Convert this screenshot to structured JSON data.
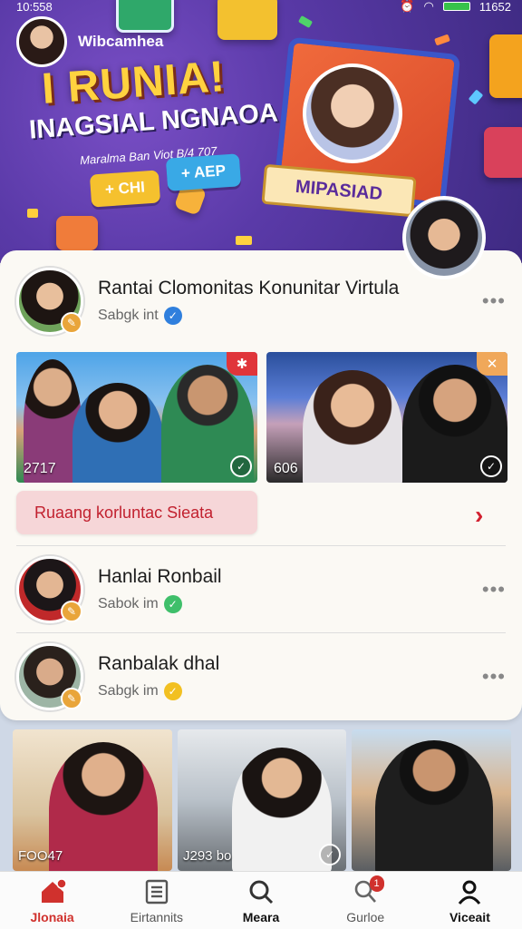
{
  "status_bar": {
    "time": "10:558",
    "right_text": "11652"
  },
  "banner": {
    "username": "Wibcamhea",
    "title": "I RUNIA!",
    "subtitle": "INAGSIAL NGNAOA",
    "caption": "Maralma Ban Viot B/4 707",
    "pill_left": "+ CHI",
    "pill_right": "+ AEP",
    "tag": "MIPASIAD"
  },
  "feed": {
    "post1": {
      "title": "Rantai Clomonitas Konunitar Virtula",
      "subtitle": "Sabgk int",
      "more": "•••",
      "check_color": "#2f7fdd"
    },
    "photos": [
      {
        "number": "2717",
        "badge": "✱",
        "badge_color": "#e0353a"
      },
      {
        "number": "606",
        "badge": "✕",
        "badge_color": "#f0a85a"
      }
    ],
    "cta_label": "Ruaang korluntac Sieata",
    "cta_arrow": "›",
    "post2": {
      "title": "Hanlai Ronbail",
      "subtitle": "Sabok im",
      "more": "•••",
      "check_color": "#3fbf6a"
    },
    "post3": {
      "title": "Ranbalak dhal",
      "subtitle": "Sabgk im",
      "more": "•••",
      "check_color": "#f2c021"
    }
  },
  "strip": [
    {
      "label": "FOO47"
    },
    {
      "label": "J293 bo"
    },
    {
      "label": ""
    }
  ],
  "nav": [
    {
      "label": "Jlonaia",
      "icon": "home-icon",
      "active": true
    },
    {
      "label": "Eirtannits",
      "icon": "list-icon",
      "active": false
    },
    {
      "label": "Meara",
      "icon": "search-icon",
      "active": false
    },
    {
      "label": "Gurloe",
      "icon": "community-icon",
      "active": false,
      "badge": "1"
    },
    {
      "label": "Viceait",
      "icon": "profile-icon",
      "active": false
    }
  ],
  "colors": {
    "accent": "#d0312d",
    "banner_bg": "#5a3aa8",
    "card_bg": "#fbf9f4"
  }
}
